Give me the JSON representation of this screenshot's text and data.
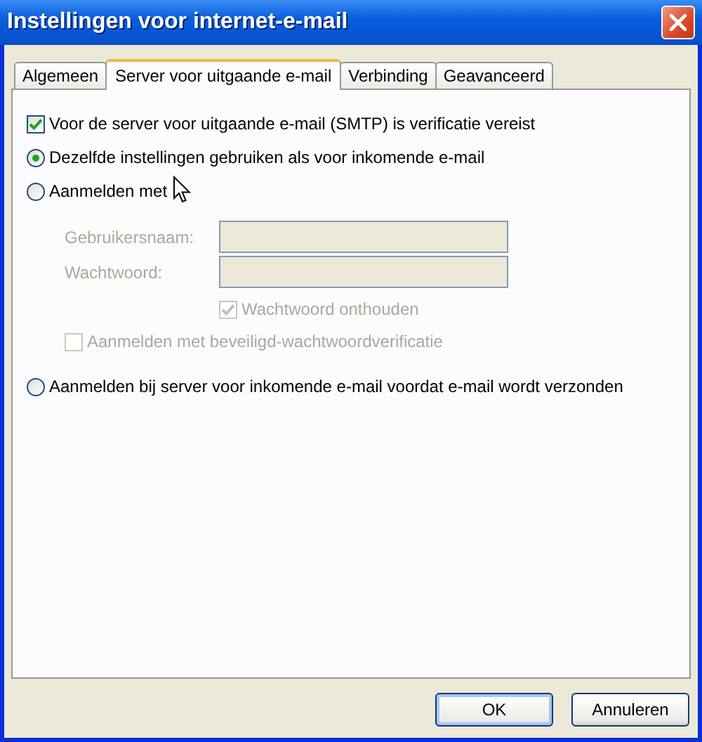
{
  "window": {
    "title": "Instellingen voor internet-e-mail"
  },
  "tabs": [
    {
      "label": "Algemeen",
      "selected": false
    },
    {
      "label": "Server voor uitgaande e-mail",
      "selected": true
    },
    {
      "label": "Verbinding",
      "selected": false
    },
    {
      "label": "Geavanceerd",
      "selected": false
    }
  ],
  "auth_required": {
    "label": "Voor de server voor uitgaande e-mail (SMTP) is verificatie vereist",
    "checked": true
  },
  "logon_options": [
    {
      "label": "Dezelfde instellingen gebruiken als voor inkomende e-mail",
      "selected": true
    },
    {
      "label": "Aanmelden met",
      "selected": false
    },
    {
      "label": "Aanmelden bij server voor inkomende e-mail voordat e-mail wordt verzonden",
      "selected": false
    }
  ],
  "credentials": {
    "fields": [
      {
        "label": "Gebruikersnaam:",
        "disabled": true
      },
      {
        "label": "Wachtwoord:",
        "disabled": true
      }
    ],
    "checks": [
      {
        "label": "Wachtwoord onthouden",
        "checked": true,
        "disabled": true,
        "kind": "remember"
      },
      {
        "label": "Aanmelden met beveiligd-wachtwoordverificatie",
        "checked": false,
        "disabled": true,
        "kind": "spa"
      }
    ]
  },
  "buttons": [
    {
      "label": "OK",
      "default": true
    },
    {
      "label": "Annuleren",
      "default": false
    }
  ]
}
